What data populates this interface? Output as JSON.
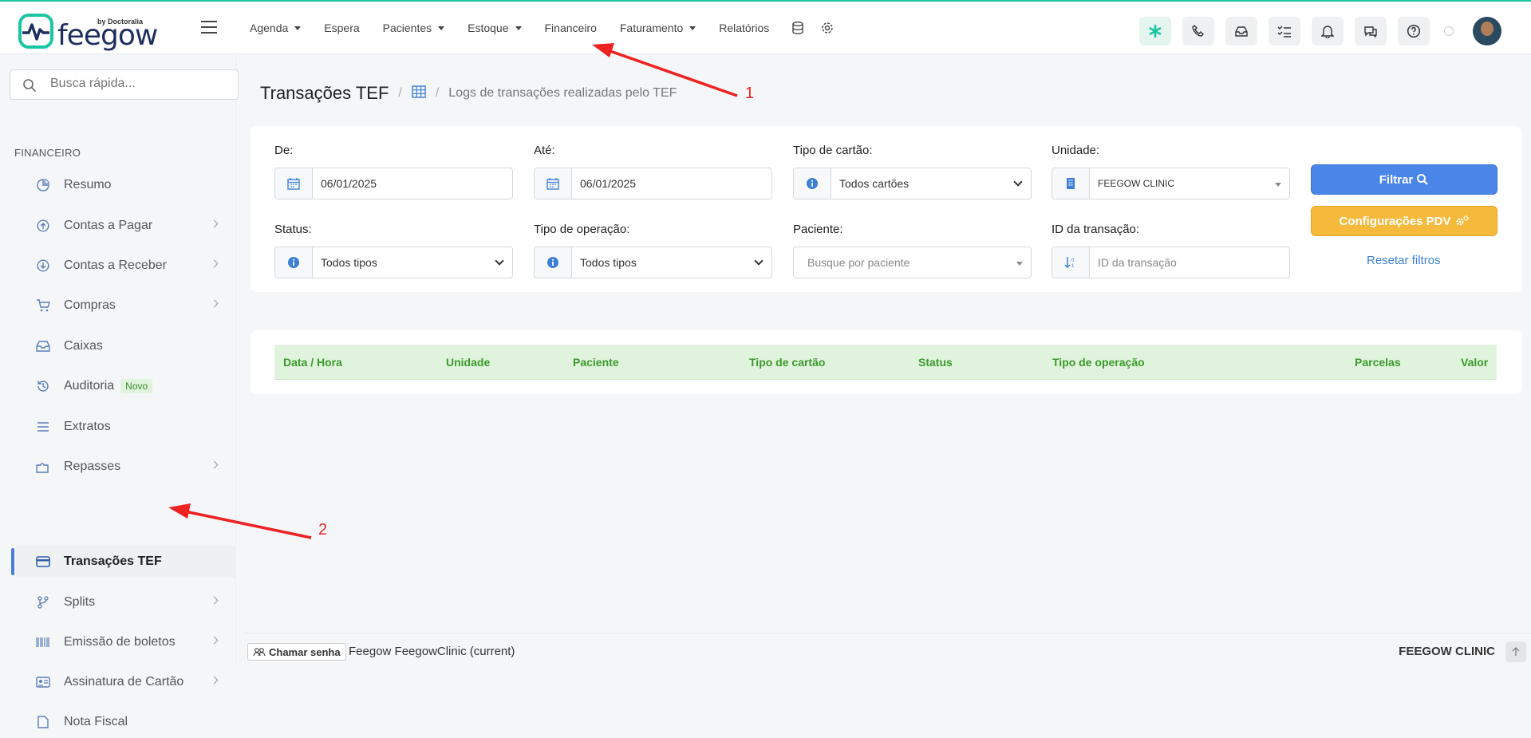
{
  "brand": {
    "name": "feegow",
    "byline": "by Doctoralia"
  },
  "topnav": {
    "items": [
      {
        "label": "Agenda",
        "dropdown": true
      },
      {
        "label": "Espera",
        "dropdown": false
      },
      {
        "label": "Pacientes",
        "dropdown": true
      },
      {
        "label": "Estoque",
        "dropdown": true
      },
      {
        "label": "Financeiro",
        "dropdown": false
      },
      {
        "label": "Faturamento",
        "dropdown": true
      },
      {
        "label": "Relatórios",
        "dropdown": false
      }
    ],
    "icons": [
      "database-icon",
      "gear-icon"
    ],
    "right_icons": [
      "asterisk-icon",
      "phone-icon",
      "inbox-icon",
      "checklist-icon",
      "bell-icon",
      "chat-icon",
      "help-icon"
    ]
  },
  "sidebar": {
    "search_placeholder": "Busca rápida...",
    "section": "FINANCEIRO",
    "items": [
      {
        "label": "Resumo",
        "icon": "pie-chart-icon",
        "chevron": false
      },
      {
        "label": "Contas a Pagar",
        "icon": "arrow-up-circle-icon",
        "chevron": true
      },
      {
        "label": "Contas a Receber",
        "icon": "arrow-down-circle-icon",
        "chevron": true
      },
      {
        "label": "Compras",
        "icon": "cart-icon",
        "chevron": true
      },
      {
        "label": "Caixas",
        "icon": "inbox-icon",
        "chevron": false
      },
      {
        "label": "Auditoria",
        "icon": "history-icon",
        "chevron": false,
        "badge": "Novo"
      },
      {
        "label": "Extratos",
        "icon": "list-icon",
        "chevron": false
      },
      {
        "label": "Repasses",
        "icon": "puzzle-icon",
        "chevron": true
      },
      {
        "label": "Transações TEF",
        "icon": "credit-card-icon",
        "chevron": false,
        "active": true
      },
      {
        "label": "Splits",
        "icon": "split-icon",
        "chevron": true
      },
      {
        "label": "Emissão de boletos",
        "icon": "barcode-icon",
        "chevron": true
      },
      {
        "label": "Assinatura de Cartão",
        "icon": "id-card-icon",
        "chevron": true
      },
      {
        "label": "Nota Fiscal",
        "icon": "document-icon",
        "chevron": true
      }
    ]
  },
  "breadcrumb": {
    "title": "Transações TEF",
    "subtitle": "Logs de transações realizadas pelo TEF"
  },
  "filters": {
    "de": {
      "label": "De:",
      "value": "06/01/2025"
    },
    "ate": {
      "label": "Até:",
      "value": "06/01/2025"
    },
    "tipo_cartao": {
      "label": "Tipo de cartão:",
      "value": "Todos cartões"
    },
    "unidade": {
      "label": "Unidade:",
      "value": "FEEGOW CLINIC"
    },
    "status": {
      "label": "Status:",
      "value": "Todos tipos"
    },
    "tipo_operacao": {
      "label": "Tipo de operação:",
      "value": "Todos tipos"
    },
    "paciente": {
      "label": "Paciente:",
      "placeholder": "Busque por paciente"
    },
    "id_transacao": {
      "label": "ID da transação:",
      "placeholder": "ID da transação"
    },
    "filtrar_label": "Filtrar",
    "config_label": "Configurações PDV",
    "reset_label": "Resetar filtros"
  },
  "table": {
    "columns": [
      "Data / Hora",
      "Unidade",
      "Paciente",
      "Tipo de cartão",
      "Status",
      "Tipo de operação",
      "Parcelas",
      "Valor"
    ],
    "rows": []
  },
  "footer": {
    "chamar_label": "Chamar senha",
    "context": "Feegow FeegowClinic (current)",
    "unit": "FEEGOW CLINIC"
  },
  "annotations": [
    "1",
    "2"
  ],
  "colors": {
    "accent": "#1bc5a4",
    "primary_button": "#4a86e8",
    "secondary_button": "#f5b93c",
    "table_header": "#e0f3dc",
    "table_header_text": "#3a9a2c",
    "annotation": "#e22222"
  }
}
